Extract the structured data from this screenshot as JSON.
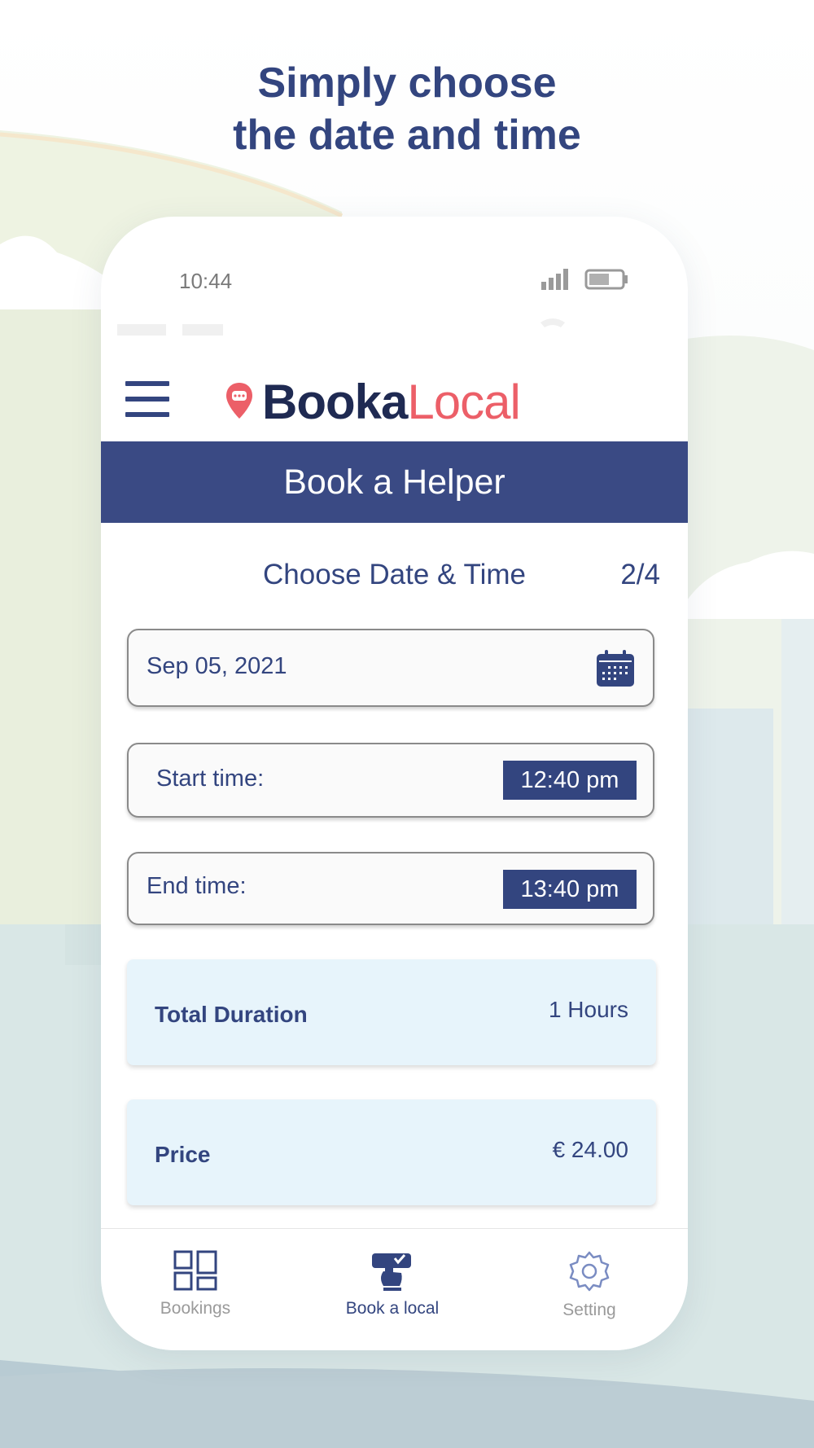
{
  "headline": {
    "line1": "Simply choose",
    "line2": "the date and time"
  },
  "status_bar": {
    "time": "10:44"
  },
  "logo": {
    "part1": "Booka",
    "part2": "Local"
  },
  "page_title": "Book a Helper",
  "step": {
    "title": "Choose Date & Time",
    "counter": "2/4"
  },
  "date_field": {
    "value": "Sep 05, 2021",
    "icon": "calendar-icon"
  },
  "start_time": {
    "label": "Start time:",
    "value": "12:40 pm"
  },
  "end_time": {
    "label": "End time:",
    "value": "13:40 pm"
  },
  "duration": {
    "label": "Total Duration",
    "value": "1 Hours"
  },
  "price": {
    "label": "Price",
    "value": "€ 24.00"
  },
  "bottom_nav": {
    "items": [
      {
        "label": "Bookings",
        "icon": "grid-icon",
        "active": false
      },
      {
        "label": "Book a local",
        "icon": "hand-tap-icon",
        "active": true
      },
      {
        "label": "Setting",
        "icon": "gear-icon",
        "active": false
      }
    ]
  },
  "colors": {
    "primary": "#33457f",
    "header_bar": "#3a4a84",
    "accent": "#ec5f68",
    "card_bg": "#e7f4fb"
  }
}
